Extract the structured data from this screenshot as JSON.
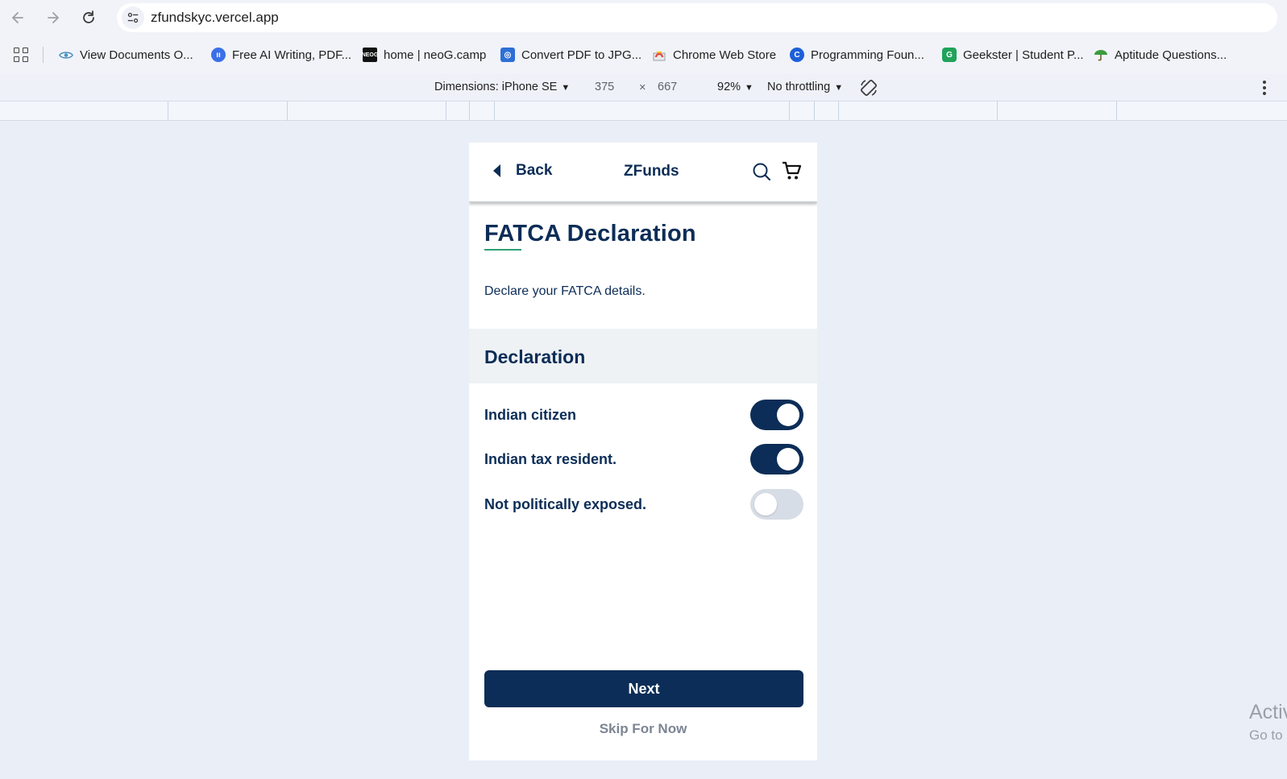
{
  "browser": {
    "url": "zfundskyc.vercel.app",
    "bookmarks": [
      {
        "label": "View Documents O...",
        "icon": "eye-icon",
        "color": "#4a90c2"
      },
      {
        "label": "Free AI Writing, PDF...",
        "icon": "ai-writing-icon",
        "color": "#3b6fe8"
      },
      {
        "label": "home | neoG.camp",
        "icon": "neog-icon",
        "color": "#111111"
      },
      {
        "label": "Convert PDF to JPG...",
        "icon": "pdf-convert-icon",
        "color": "#2d6fd6"
      },
      {
        "label": "Chrome Web Store",
        "icon": "chrome-store-icon",
        "color": "#e8453c"
      },
      {
        "label": "Programming Foun...",
        "icon": "c-logo-icon",
        "color": "#1d5fd8"
      },
      {
        "label": "Geekster | Student P...",
        "icon": "geekster-icon",
        "color": "#1fa35a"
      },
      {
        "label": "Aptitude Questions...",
        "icon": "umbrella-icon",
        "color": "#3b9c3b"
      }
    ]
  },
  "devtools": {
    "dimensions_label": "Dimensions: iPhone SE",
    "width": "375",
    "times": "×",
    "height": "667",
    "zoom": "92%",
    "throttling": "No throttling"
  },
  "app": {
    "back_label": "Back",
    "title": "ZFunds",
    "page_title": "FATCA Declaration",
    "page_subtitle": "Declare your FATCA details.",
    "section_title": "Declaration",
    "toggles": [
      {
        "label": "Indian citizen",
        "checked": true
      },
      {
        "label": "Indian tax resident.",
        "checked": true
      },
      {
        "label": "Not politically exposed.",
        "checked": false
      }
    ],
    "next_label": "Next",
    "skip_label": "Skip For Now",
    "accent_color": "#0c2d57",
    "underline_color": "#2e9f74"
  },
  "os_overlay": {
    "line1": "Activ",
    "line2": "Go to"
  }
}
